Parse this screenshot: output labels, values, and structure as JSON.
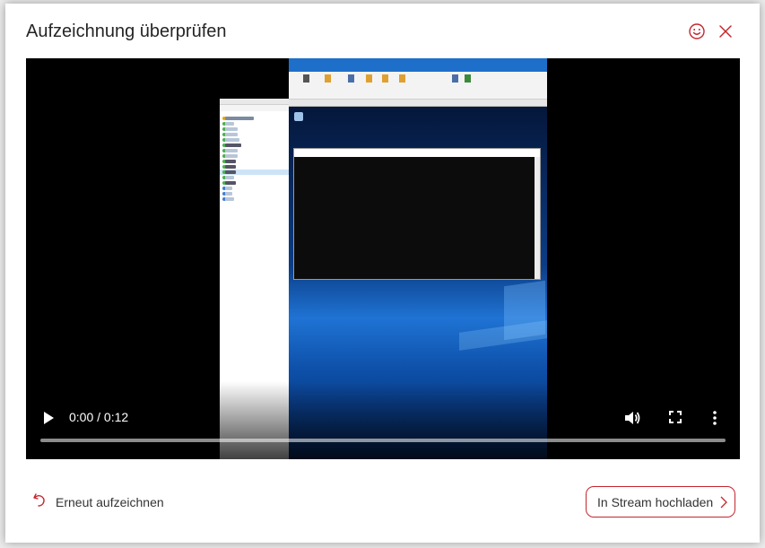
{
  "dialog": {
    "title": "Aufzeichnung überprüfen",
    "smiley_icon": "smiley-icon",
    "close_icon": "close-icon"
  },
  "video": {
    "time_current": "0:00",
    "time_total": "0:12",
    "timecode": "0:00 / 0:12",
    "progress": 0,
    "icons": [
      "play-icon",
      "volume-icon",
      "fullscreen-icon",
      "more-options-icon"
    ]
  },
  "footer": {
    "rerecord_label": "Erneut aufzeichnen",
    "upload_label": "In Stream hochladen"
  },
  "colors": {
    "accent": "#c4262e",
    "title_text": "#252525",
    "video_bg": "#000000"
  }
}
